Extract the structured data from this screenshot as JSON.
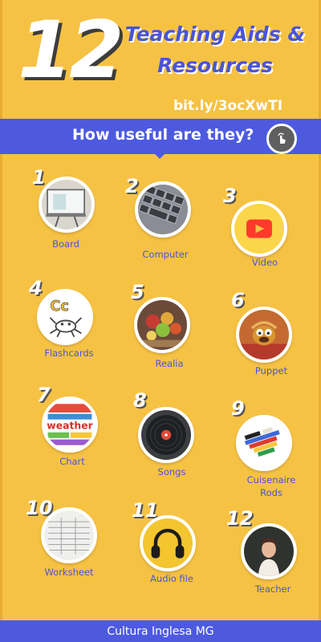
{
  "header": {
    "number": "12",
    "title_line1": "Teaching Aids &",
    "title_line2": "Resources",
    "url": "bit.ly/3ocXwTI"
  },
  "banner": {
    "question": "How useful are they?",
    "button_icon": "hand-tap-icon"
  },
  "items": [
    {
      "number": "1",
      "label": "Board",
      "icon": "whiteboard-icon"
    },
    {
      "number": "2",
      "label": "Computer",
      "icon": "keyboard-icon"
    },
    {
      "number": "3",
      "label": "Video",
      "icon": "play-button-icon"
    },
    {
      "number": "4",
      "label": "Flashcards",
      "icon": "crab-flashcard-icon"
    },
    {
      "number": "5",
      "label": "Realia",
      "icon": "fruit-basket-icon"
    },
    {
      "number": "6",
      "label": "Puppet",
      "icon": "puppet-icon"
    },
    {
      "number": "7",
      "label": "Chart",
      "icon": "weather-chart-icon"
    },
    {
      "number": "8",
      "label": "Songs",
      "icon": "vinyl-record-icon"
    },
    {
      "number": "9",
      "label": "Cuisenaire",
      "label2": "Rods",
      "icon": "rods-icon"
    },
    {
      "number": "10",
      "label": "Worksheet",
      "icon": "worksheet-icon"
    },
    {
      "number": "11",
      "label": "Audio file",
      "icon": "headphones-icon"
    },
    {
      "number": "12",
      "label": "Teacher",
      "icon": "teacher-icon"
    }
  ],
  "footer": {
    "text": "Cultura Inglesa MG"
  },
  "colors": {
    "background": "#f6c244",
    "accent": "#4d5ae0",
    "label": "#4a54d8"
  }
}
